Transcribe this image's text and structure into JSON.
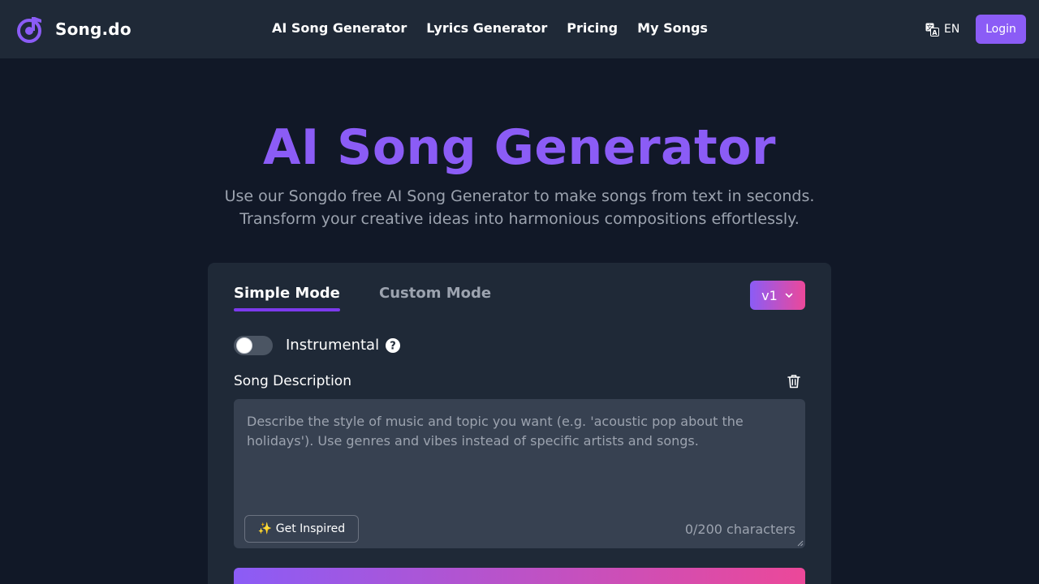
{
  "brand": {
    "name": "Song.do"
  },
  "nav": {
    "items": [
      {
        "label": "AI Song Generator"
      },
      {
        "label": "Lyrics Generator"
      },
      {
        "label": "Pricing"
      },
      {
        "label": "My Songs"
      }
    ]
  },
  "header": {
    "language": "EN",
    "login_label": "Login"
  },
  "hero": {
    "title": "AI Song Generator",
    "subtitle_line1": "Use our Songdo free AI Song Generator to make songs from text in seconds.",
    "subtitle_line2": "Transform your creative ideas into harmonious compositions effortlessly."
  },
  "card": {
    "tabs": [
      {
        "label": "Simple Mode",
        "active": true
      },
      {
        "label": "Custom Mode",
        "active": false
      }
    ],
    "version": "v1",
    "instrumental_label": "Instrumental",
    "instrumental_on": false,
    "description_label": "Song Description",
    "description_value": "",
    "description_placeholder": "Describe the style of music and topic you want (e.g. 'acoustic pop about the holidays'). Use genres and vibes instead of specific artists and songs.",
    "inspire_label": "✨ Get Inspired",
    "char_count": "0/200 characters"
  },
  "colors": {
    "accent": "#8b5cf6",
    "accent_pink": "#ec4899",
    "background": "#111827",
    "surface": "#1f2937",
    "input": "#374151",
    "muted_text": "#9ca3af"
  },
  "icons": {
    "logo": "music-note-logo-icon",
    "language": "translate-icon",
    "version_dropdown": "chevron-down-icon",
    "help": "question-circle-icon",
    "clear": "trash-icon"
  }
}
